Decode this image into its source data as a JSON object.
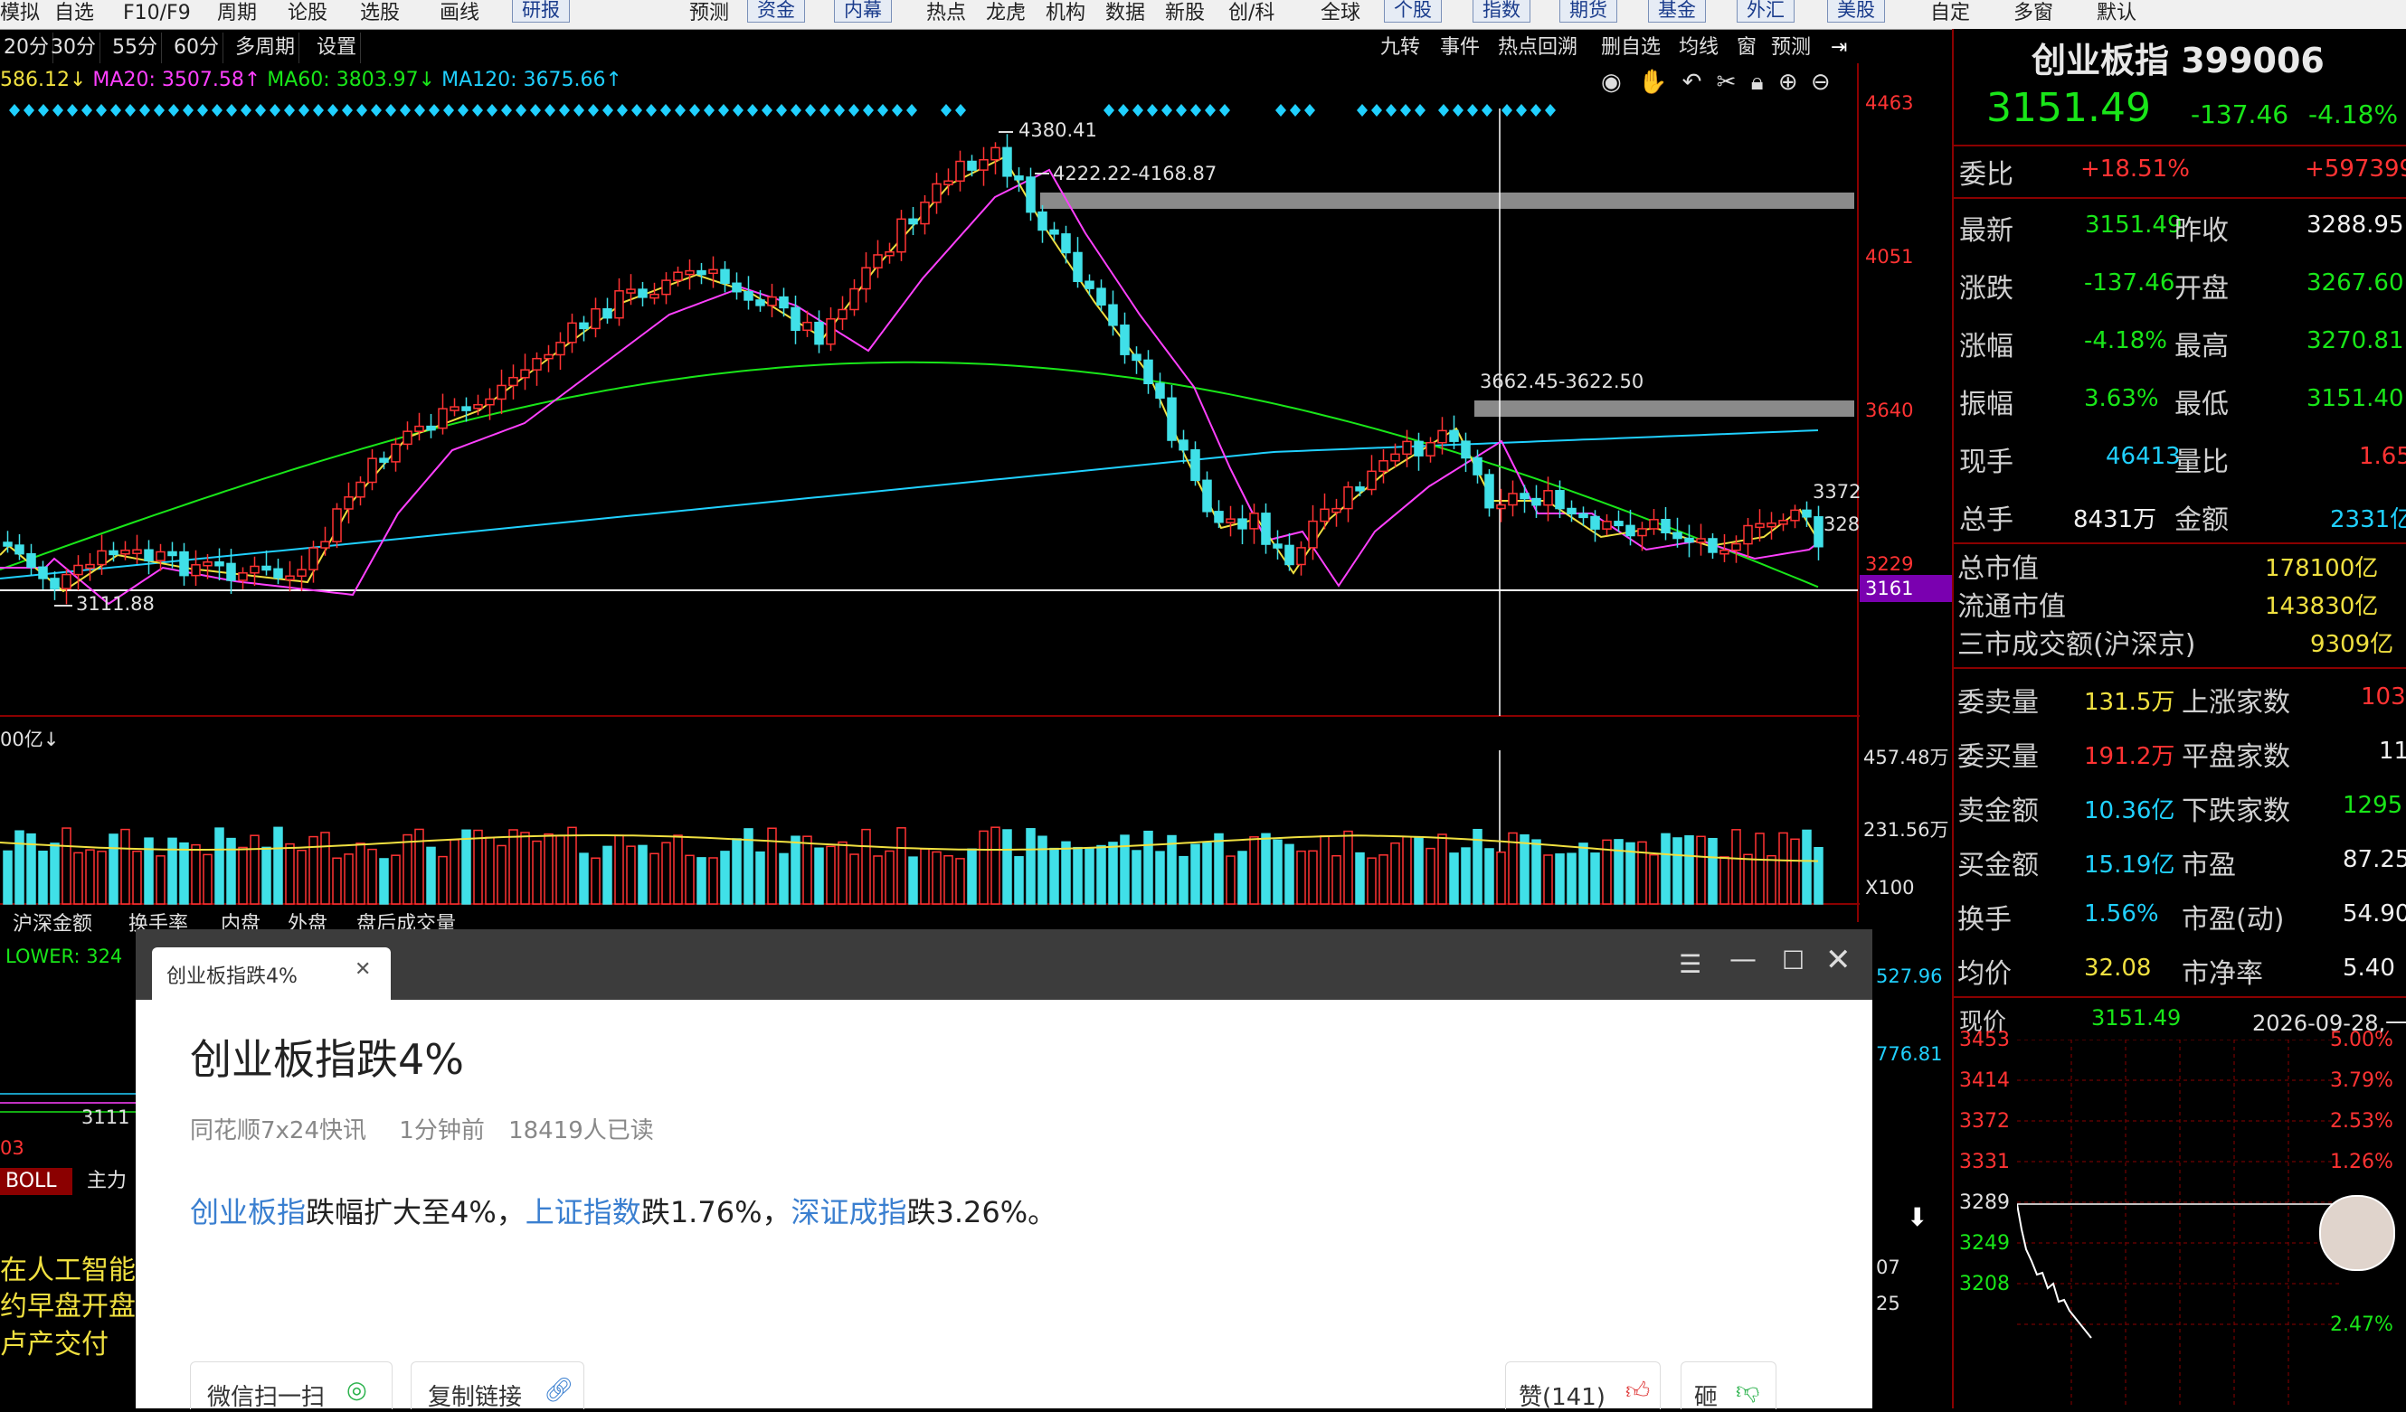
{
  "top_menu": {
    "items": [
      "模拟",
      "自选",
      "F10/F9",
      "周期",
      "论股",
      "选股",
      "画线",
      "研报",
      "预测",
      "资金",
      "内幕",
      "热点",
      "龙虎",
      "机构",
      "数据",
      "新股",
      "创/科",
      "全球",
      "个股",
      "指数",
      "期货",
      "基金",
      "外汇",
      "美股",
      "自定",
      "多窗",
      "默认"
    ],
    "tabbed": [
      "研报",
      "资金",
      "内幕",
      "个股",
      "指数",
      "期货",
      "基金",
      "外汇",
      "美股"
    ]
  },
  "period_bar": [
    "20分",
    "30分",
    "55分",
    "60分",
    "多周期",
    "设置"
  ],
  "chart_tools": [
    "九转",
    "事件",
    "热点回溯",
    "删自选",
    "均线",
    "窗",
    "预测"
  ],
  "ma_legend": [
    {
      "text": "586.12↓",
      "color": "#f0e040"
    },
    {
      "text": "MA20: 3507.58↑",
      "color": "#ff40ff"
    },
    {
      "text": "MA60: 3803.97↓",
      "color": "#19e619"
    },
    {
      "text": "MA120: 3675.66↑",
      "color": "#20d0ff"
    }
  ],
  "price_axis": [
    "4463",
    "4051",
    "3640",
    "3372",
    "328",
    "3229",
    "3161"
  ],
  "annotations": {
    "high": "4380.41",
    "gap1": "4222.22-4168.87",
    "gap2": "3662.45-3622.50",
    "low": "3111.88"
  },
  "volume": {
    "legend": "00亿↓",
    "axis": [
      "457.48万",
      "231.56万",
      "X100"
    ]
  },
  "sub_tabs": [
    "沪深金额",
    "换手率",
    "内盘",
    "外盘",
    "盘后成交量"
  ],
  "lower_indicator": {
    "legend": "LOWER: 324",
    "mini_low": "3111",
    "label_03": "03",
    "boll": "BOLL",
    "main": "主力",
    "right_axis": [
      "527.96",
      "776.81",
      "07",
      "25"
    ]
  },
  "news_ticker": [
    "在人工智能事",
    "约早盘开盘",
    "卢产交付"
  ],
  "right_panel": {
    "index_name": "创业板指 399006",
    "price": "3151.49",
    "change": "-137.46",
    "change_pct": "-4.18%",
    "rows": [
      {
        "l": "委比",
        "v": "+18.51%",
        "l2": "",
        "v2": "+597399"
      },
      {
        "l": "最新",
        "v": "3151.49",
        "l2": "昨收",
        "v2": "3288.95"
      },
      {
        "l": "涨跌",
        "v": "-137.46",
        "l2": "开盘",
        "v2": "3267.60"
      },
      {
        "l": "涨幅",
        "v": "-4.18%",
        "l2": "最高",
        "v2": "3270.81"
      },
      {
        "l": "振幅",
        "v": "3.63%",
        "l2": "最低",
        "v2": "3151.40"
      },
      {
        "l": "现手",
        "v": "46413",
        "l2": "量比",
        "v2": "1.65"
      },
      {
        "l": "总手",
        "v": "8431万",
        "l2": "金额",
        "v2": "2331亿"
      }
    ],
    "market": [
      {
        "l": "总市值",
        "v": "178100亿"
      },
      {
        "l": "流通市值",
        "v": "143830亿"
      },
      {
        "l": "三市成交额(沪深京)",
        "v": "9309亿"
      }
    ],
    "orders": [
      {
        "l": "委卖量",
        "v": "131.5万",
        "l2": "上涨家数",
        "v2": "103"
      },
      {
        "l": "委买量",
        "v": "191.2万",
        "l2": "平盘家数",
        "v2": "11"
      },
      {
        "l": "卖金额",
        "v": "10.36亿",
        "l2": "下跌家数",
        "v2": "1295"
      },
      {
        "l": "买金额",
        "v": "15.19亿",
        "l2": "市盈",
        "v2": "87.25"
      },
      {
        "l": "换手",
        "v": "1.56%",
        "l2": "市盈(动)",
        "v2": "54.90"
      },
      {
        "l": "均价",
        "v": "32.08",
        "l2": "市净率",
        "v2": "5.40"
      }
    ],
    "intraday": {
      "label": "现价",
      "price": "3151.49",
      "date": "2026-09-28,一",
      "left_axis": [
        "3453",
        "3414",
        "3372",
        "3331",
        "3289",
        "3249",
        "3208"
      ],
      "right_axis": [
        "5.00%",
        "3.79%",
        "2.53%",
        "1.26%",
        "2.47%"
      ]
    }
  },
  "popup": {
    "tab_title": "创业板指跌4%",
    "title": "创业板指跌4%",
    "source": "同花顺7x24快讯",
    "time": "1分钟前",
    "reads": "18419人已读",
    "body": {
      "link1": "创业板指",
      "t1": "跌幅扩大至4%，",
      "link2": "上证指数",
      "t2": "跌1.76%，",
      "link3": "深证成指",
      "t3": "跌3.26%。"
    },
    "share_wechat": "微信扫一扫",
    "copy_link": "复制链接",
    "like": "赞(141)",
    "dislike": "砸"
  },
  "colors": {
    "up": "#ff3333",
    "down": "#40e0e8",
    "bg": "#000000",
    "grid": "#8b0000"
  }
}
